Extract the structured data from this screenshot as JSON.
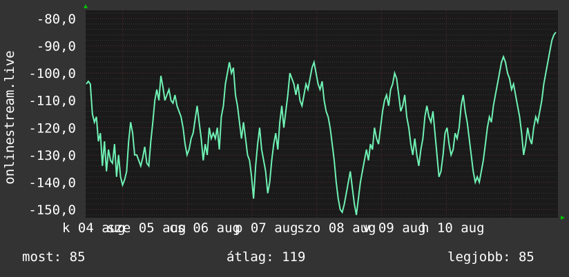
{
  "chart_data": {
    "type": "line",
    "ylabel": "onlinestream.live",
    "ylim": [
      -153,
      -77
    ],
    "y_ticks": [
      -80,
      -90,
      -100,
      -110,
      -120,
      -130,
      -140,
      -150
    ],
    "y_tick_labels": [
      "-80,0",
      "-90,0",
      "-100,0",
      "-110,0",
      "-120,0",
      "-130,0",
      "-140,0",
      "-150,0"
    ],
    "x_tick_labels": [
      "k 04 aug",
      "sze 05 aug",
      "cs 06 aug",
      "p 07 aug",
      "szo 08 aug",
      "v 09 aug",
      "h 10 aug"
    ],
    "grid": true,
    "series": [
      {
        "values": [
          -104,
          -103,
          -104,
          -115,
          -118,
          -116,
          -125,
          -122,
          -134,
          -125,
          -136,
          -128,
          -132,
          -133,
          -126,
          -138,
          -130,
          -138,
          -141,
          -139,
          -136,
          -125,
          -118,
          -122,
          -130,
          -130,
          -132,
          -134,
          -131,
          -127,
          -133,
          -134,
          -125,
          -118,
          -110,
          -106,
          -110,
          -101,
          -105,
          -110,
          -108,
          -106,
          -110,
          -111,
          -108,
          -112,
          -114,
          -116,
          -120,
          -126,
          -130,
          -128,
          -124,
          -122,
          -117,
          -112,
          -118,
          -124,
          -132,
          -126,
          -130,
          -120,
          -124,
          -122,
          -124,
          -120,
          -128,
          -116,
          -112,
          -104,
          -100,
          -96,
          -100,
          -98,
          -108,
          -112,
          -118,
          -124,
          -118,
          -124,
          -130,
          -132,
          -138,
          -146,
          -134,
          -126,
          -120,
          -128,
          -132,
          -136,
          -144,
          -140,
          -132,
          -126,
          -122,
          -128,
          -118,
          -112,
          -120,
          -114,
          -108,
          -100,
          -102,
          -104,
          -108,
          -104,
          -110,
          -112,
          -108,
          -104,
          -106,
          -102,
          -98,
          -96,
          -100,
          -104,
          -106,
          -103,
          -110,
          -114,
          -116,
          -120,
          -126,
          -132,
          -140,
          -146,
          -150,
          -151,
          -148,
          -144,
          -140,
          -136,
          -142,
          -148,
          -152,
          -146,
          -140,
          -136,
          -132,
          -128,
          -132,
          -126,
          -128,
          -120,
          -124,
          -126,
          -120,
          -114,
          -110,
          -108,
          -112,
          -106,
          -104,
          -100,
          -102,
          -108,
          -114,
          -112,
          -108,
          -116,
          -120,
          -126,
          -130,
          -124,
          -130,
          -134,
          -128,
          -124,
          -116,
          -112,
          -116,
          -118,
          -114,
          -122,
          -130,
          -138,
          -136,
          -130,
          -122,
          -120,
          -126,
          -130,
          -128,
          -122,
          -124,
          -120,
          -112,
          -108,
          -114,
          -118,
          -124,
          -130,
          -136,
          -140,
          -138,
          -140,
          -136,
          -132,
          -126,
          -120,
          -116,
          -118,
          -112,
          -108,
          -104,
          -100,
          -96,
          -94,
          -96,
          -100,
          -102,
          -106,
          -104,
          -108,
          -112,
          -116,
          -122,
          -130,
          -126,
          -120,
          -124,
          -126,
          -120,
          -116,
          -118,
          -114,
          -110,
          -104,
          -100,
          -96,
          -92,
          -88,
          -86,
          -85
        ]
      }
    ]
  },
  "stats": {
    "current": "most: 85",
    "average": "átlag: 119",
    "max": "legjobb: 85"
  },
  "colors": {
    "background": "#333333",
    "plot_bg": "#1a1a1a",
    "line": "#6ff2b4",
    "grid_major": "#5a2a30",
    "grid_minor": "#3a3a3a",
    "arrow": "#00c000"
  }
}
